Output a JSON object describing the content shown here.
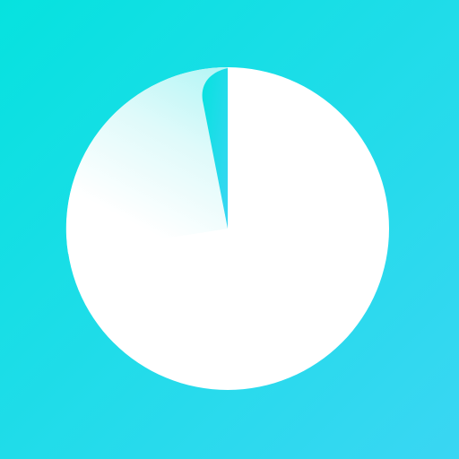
{
  "icon": {
    "name": "pie-timer-app-icon",
    "shape": "pie-timer",
    "colors": {
      "background_start": "#06E2DF",
      "background_end": "#3AD6F3",
      "disc": "#FFFFFF",
      "peel_fade_start": "#B6F6F6",
      "peel_fade_end": "#FFFFFF"
    }
  }
}
